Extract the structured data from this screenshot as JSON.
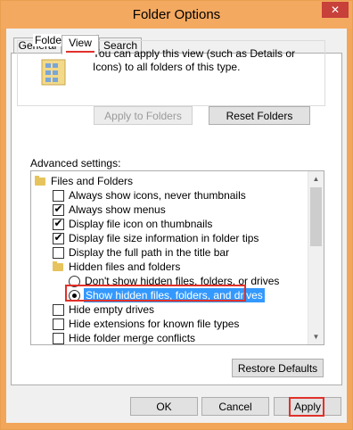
{
  "window": {
    "title": "Folder Options",
    "close_glyph": "✕"
  },
  "tabs": [
    {
      "label": "General",
      "active": false
    },
    {
      "label": "View",
      "active": true
    },
    {
      "label": "Search",
      "active": false
    }
  ],
  "folder_views": {
    "group_label": "Folder views",
    "description": "You can apply this view (such as Details or Icons) to all folders of this type.",
    "apply_button": "Apply to Folders",
    "reset_button": "Reset Folders"
  },
  "advanced": {
    "label": "Advanced settings:",
    "items": [
      {
        "type": "folder",
        "label": "Files and Folders",
        "indent": 0
      },
      {
        "type": "checkbox",
        "label": "Always show icons, never thumbnails",
        "checked": false,
        "indent": 1
      },
      {
        "type": "checkbox",
        "label": "Always show menus",
        "checked": true,
        "indent": 1
      },
      {
        "type": "checkbox",
        "label": "Display file icon on thumbnails",
        "checked": true,
        "indent": 1
      },
      {
        "type": "checkbox",
        "label": "Display file size information in folder tips",
        "checked": true,
        "indent": 1
      },
      {
        "type": "checkbox",
        "label": "Display the full path in the title bar",
        "checked": false,
        "indent": 1
      },
      {
        "type": "folder",
        "label": "Hidden files and folders",
        "indent": 1
      },
      {
        "type": "radio",
        "label": "Don't show hidden files, folders, or drives",
        "checked": false,
        "indent": 2
      },
      {
        "type": "radio",
        "label": "Show hidden files, folders, and drives",
        "checked": true,
        "indent": 2,
        "highlighted": true
      },
      {
        "type": "checkbox",
        "label": "Hide empty drives",
        "checked": false,
        "indent": 1
      },
      {
        "type": "checkbox",
        "label": "Hide extensions for known file types",
        "checked": false,
        "indent": 1
      },
      {
        "type": "checkbox",
        "label": "Hide folder merge conflicts",
        "checked": false,
        "indent": 1
      }
    ],
    "restore_button": "Restore Defaults"
  },
  "footer": {
    "ok": "OK",
    "cancel": "Cancel",
    "apply": "Apply"
  },
  "colors": {
    "highlight": "#e0312b",
    "selection": "#3399ff",
    "titlebar": "#f4a960"
  }
}
